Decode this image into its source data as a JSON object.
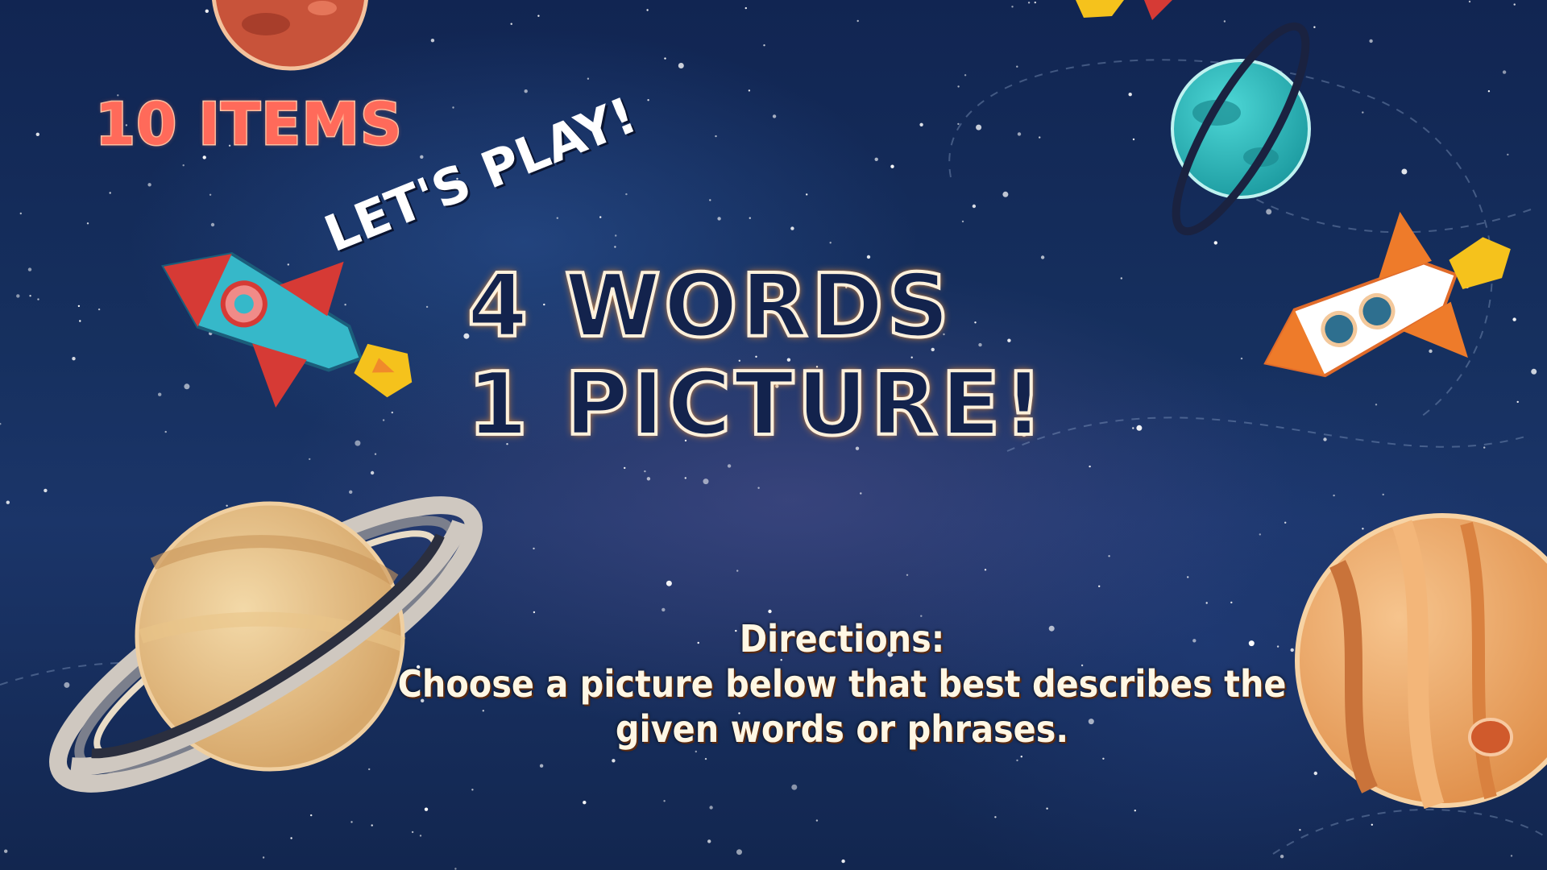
{
  "game": {
    "item_count_label": "10 ITEMS",
    "intro_label": "LET'S PLAY!",
    "title_line_1": "4 WORDS",
    "title_line_2": "1 PICTURE!",
    "directions_heading": "Directions:",
    "directions_text": "Choose a picture below that best describes the given words or phrases."
  },
  "theme": {
    "background": "#16305f",
    "title_outline": "#e8913a",
    "badge_color": "#ff6a5a"
  },
  "decorations": [
    "saturn-planet",
    "jupiter-planet",
    "teal-ringed-planet",
    "red-planet",
    "left-rocket",
    "right-rocket",
    "stars"
  ]
}
